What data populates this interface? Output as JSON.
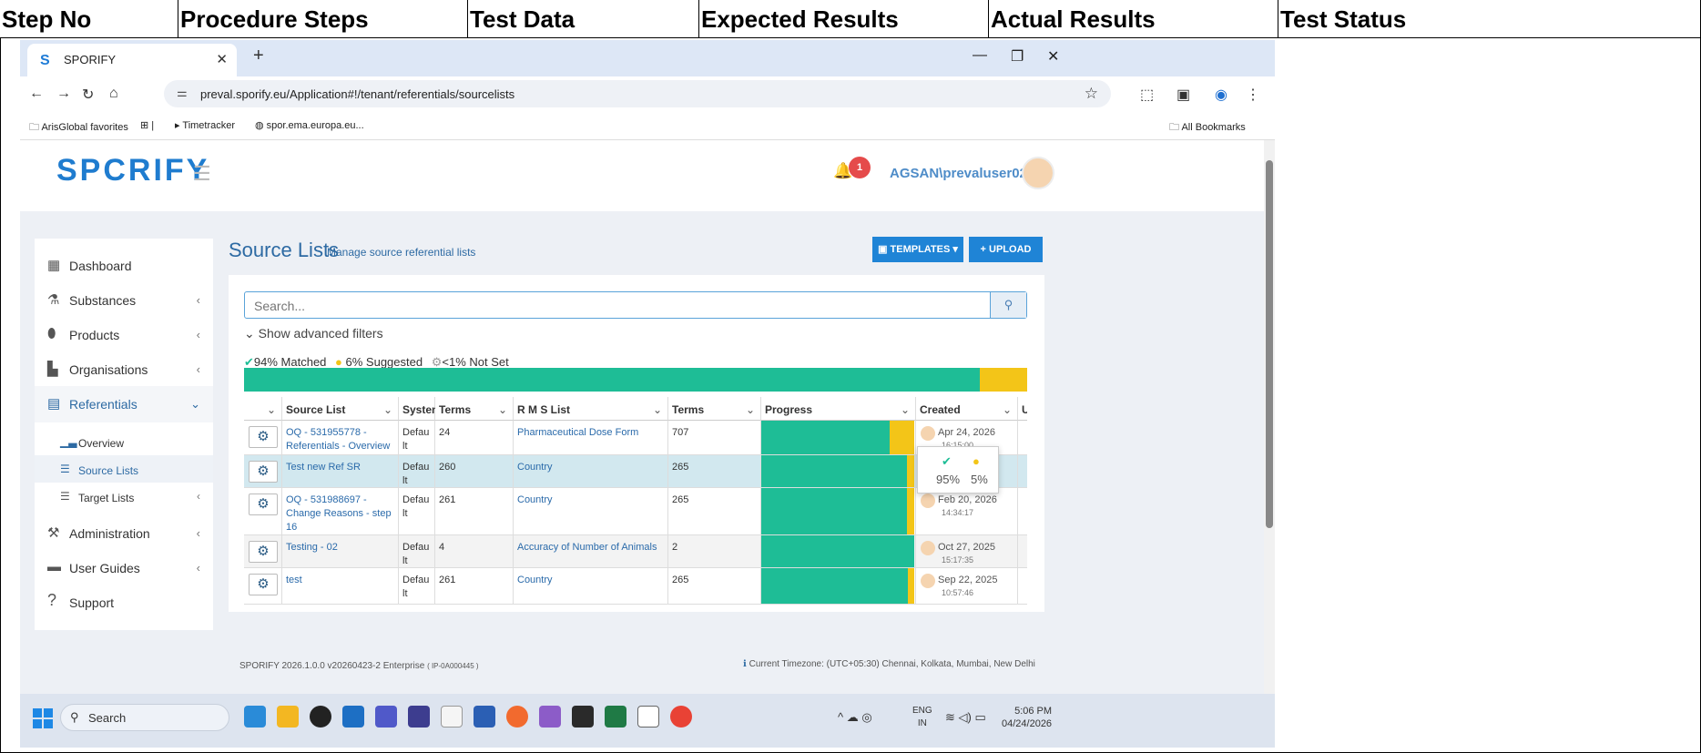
{
  "doc_table": {
    "headers": [
      "Step No",
      "Procedure Steps",
      "Test Data",
      "Expected Results",
      "Actual Results",
      "Test Status"
    ]
  },
  "browser": {
    "tab_title": "SPORIFY",
    "url": "preval.sporify.eu/Application#!/tenant/referentials/sourcelists",
    "bookmarks": [
      "ArisGlobal favorites",
      "Timetracker",
      "spor.ema.europa.eu..."
    ],
    "all_bookmarks": "All Bookmarks"
  },
  "app": {
    "logo": "SPCRIFY",
    "notification_count": "1",
    "user": "AGSAN\\prevaluser02",
    "sidebar": {
      "items": [
        {
          "label": "Dashboard",
          "icon": "dashboard-icon"
        },
        {
          "label": "Substances",
          "icon": "flask-icon"
        },
        {
          "label": "Products",
          "icon": "pills-icon"
        },
        {
          "label": "Organisations",
          "icon": "factory-icon"
        },
        {
          "label": "Referentials",
          "icon": "book-icon"
        },
        {
          "label": "Overview",
          "icon": "bar-chart-icon"
        },
        {
          "label": "Source Lists",
          "icon": "list-icon"
        },
        {
          "label": "Target Lists",
          "icon": "list-icon"
        },
        {
          "label": "Administration",
          "icon": "wrench-icon"
        },
        {
          "label": "User Guides",
          "icon": "guide-icon"
        },
        {
          "label": "Support",
          "icon": "question-icon"
        }
      ]
    },
    "page_title": "Source Lists",
    "page_subtitle": "Manage source referential lists",
    "templates_btn": "TEMPLATES",
    "upload_btn": "UPLOAD",
    "search_placeholder": "Search...",
    "advanced_filters": "Show advanced filters",
    "stats": {
      "matched": "94% Matched",
      "suggested": "6% Suggested",
      "notset": "<1% Not Set"
    },
    "progress": {
      "matched": 0.94,
      "suggested": 0.06
    },
    "columns": [
      "Source List",
      "System",
      "Terms",
      "R M S List",
      "Terms",
      "Progress",
      "Created"
    ],
    "rows": [
      {
        "source": "OQ - 531955778 - Referentials - Overview",
        "system": "Default",
        "terms": "24",
        "rms": "Pharmaceutical Dose Form",
        "rms_terms": "707",
        "matched": 0.84,
        "suggested": 0.16,
        "date": "Apr 24, 2026",
        "time": "16:15:00"
      },
      {
        "source": "Test new Ref SR",
        "system": "Default",
        "terms": "260",
        "rms": "Country",
        "rms_terms": "265",
        "matched": 0.95,
        "suggested": 0.05,
        "date": "",
        "time": ""
      },
      {
        "source": "OQ - 531988697 - Change Reasons - step 16",
        "system": "Default",
        "terms": "261",
        "rms": "Country",
        "rms_terms": "265",
        "matched": 0.95,
        "suggested": 0.05,
        "date": "Feb 20, 2026",
        "time": "14:34:17"
      },
      {
        "source": "Testing - 02",
        "system": "Default",
        "terms": "4",
        "rms": "Accuracy of Number of Animals",
        "rms_terms": "2",
        "matched": 1.0,
        "suggested": 0.0,
        "date": "Oct 27, 2025",
        "time": "15:17:35"
      },
      {
        "source": "test",
        "system": "Default",
        "terms": "261",
        "rms": "Country",
        "rms_terms": "265",
        "matched": 0.96,
        "suggested": 0.04,
        "date": "Sep 22, 2025",
        "time": "10:57:46"
      }
    ],
    "tooltip": {
      "matched": "95%",
      "suggested": "5%"
    },
    "footer_left": "SPORIFY 2026.1.0.0 v20260423-2 Enterprise",
    "footer_left_small": "( IP-0A000445 )",
    "footer_right": "Current Timezone: (UTC+05:30) Chennai, Kolkata, Mumbai, New Delhi"
  },
  "taskbar": {
    "search": "Search",
    "lang1": "ENG",
    "lang2": "IN",
    "time": "5:06 PM",
    "date": "04/24/2026"
  }
}
